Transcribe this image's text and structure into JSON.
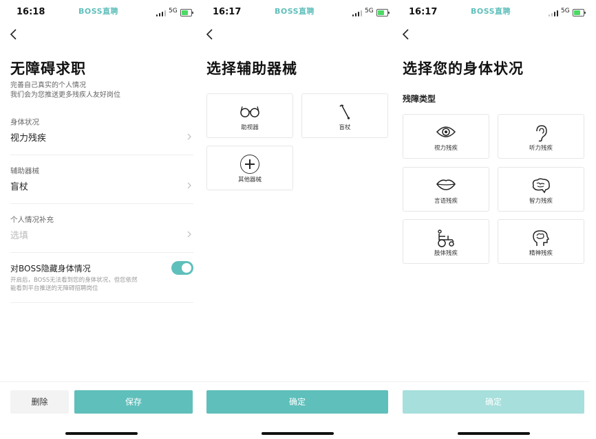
{
  "panel1": {
    "status": {
      "time": "16:18",
      "brand": "BOSS直聘",
      "network": "5G"
    },
    "title": "无障碍求职",
    "subtitle_line1": "完善自己真实的个人情况",
    "subtitle_line2": "我们会为您推送更多残疾人友好岗位",
    "fields": [
      {
        "label": "身体状况",
        "value": "视力残疾"
      },
      {
        "label": "辅助器械",
        "value": "盲杖"
      },
      {
        "label": "个人情况补充",
        "placeholder": "选填"
      }
    ],
    "toggle": {
      "label": "对BOSS隐藏身体情况",
      "on": true,
      "desc_line1": "开启后，BOSS无法看到您的身体状况，但您依然",
      "desc_line2": "能看到平台推送的无障碍招聘岗位"
    },
    "footer": {
      "delete_label": "删除",
      "save_label": "保存"
    }
  },
  "panel2": {
    "status": {
      "time": "16:17",
      "brand": "BOSS直聘",
      "network": "5G"
    },
    "title": "选择辅助器械",
    "options": [
      {
        "label": "助视器",
        "icon": "glasses-icon"
      },
      {
        "label": "盲杖",
        "icon": "cane-icon"
      },
      {
        "label": "其他器械",
        "icon": "plus-icon"
      }
    ],
    "footer": {
      "confirm_label": "确定"
    }
  },
  "panel3": {
    "status": {
      "time": "16:17",
      "brand": "BOSS直聘",
      "network": "5G"
    },
    "title": "选择您的身体状况",
    "section_label": "残障类型",
    "options": [
      {
        "label": "视力残疾",
        "icon": "eye-icon"
      },
      {
        "label": "听力残疾",
        "icon": "ear-icon"
      },
      {
        "label": "言语残疾",
        "icon": "lips-icon"
      },
      {
        "label": "智力残疾",
        "icon": "brain-icon"
      },
      {
        "label": "肢体残疾",
        "icon": "wheelchair-icon"
      },
      {
        "label": "精神残疾",
        "icon": "head-icon"
      }
    ],
    "footer": {
      "confirm_label": "确定",
      "confirm_disabled": true
    }
  },
  "colors": {
    "accent": "#5fbfbb",
    "accent_disabled": "#a6dfdc",
    "brand": "#5fbfbb"
  }
}
